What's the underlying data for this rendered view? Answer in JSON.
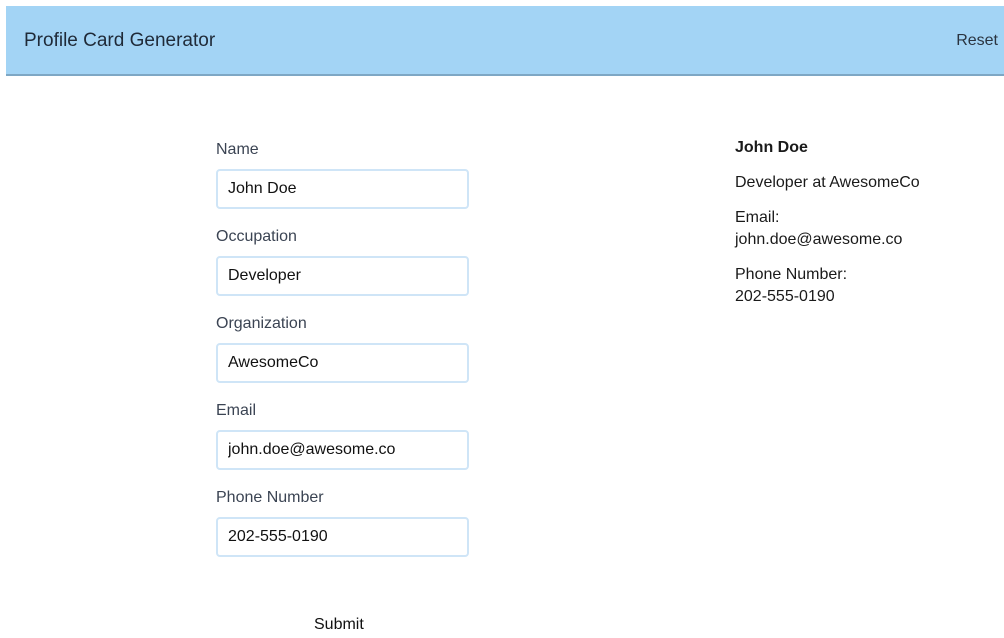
{
  "header": {
    "title": "Profile Card Generator",
    "reset_label": "Reset"
  },
  "form": {
    "fields": [
      {
        "label": "Name",
        "value": "John Doe"
      },
      {
        "label": "Occupation",
        "value": "Developer"
      },
      {
        "label": "Organization",
        "value": "AwesomeCo"
      },
      {
        "label": "Email",
        "value": "john.doe@awesome.co"
      },
      {
        "label": "Phone Number",
        "value": "202-555-0190"
      }
    ],
    "submit_label": "Submit"
  },
  "card": {
    "name": "John Doe",
    "role_line": "Developer at AwesomeCo",
    "email_label": "Email:",
    "email_value": "john.doe@awesome.co",
    "phone_label": "Phone Number:",
    "phone_value": "202-555-0190"
  },
  "colors": {
    "header_bg": "#a3d4f5",
    "input_border": "#cfe5f7"
  }
}
